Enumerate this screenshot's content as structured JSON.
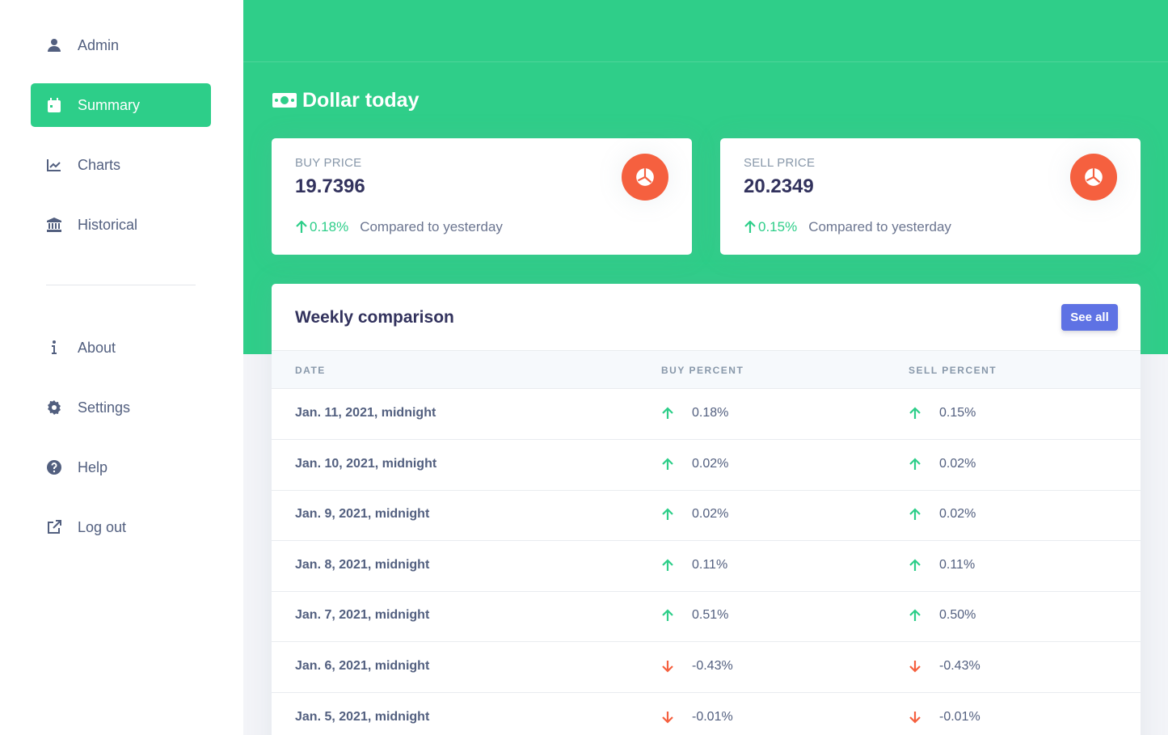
{
  "sidebar": {
    "items": [
      {
        "label": "Admin",
        "icon": "user-icon"
      },
      {
        "label": "Summary",
        "icon": "calendar-icon",
        "active": true
      },
      {
        "label": "Charts",
        "icon": "chart-line-icon"
      },
      {
        "label": "Historical",
        "icon": "bank-icon"
      },
      {
        "label": "About",
        "icon": "info-icon"
      },
      {
        "label": "Settings",
        "icon": "gear-icon"
      },
      {
        "label": "Help",
        "icon": "question-icon"
      },
      {
        "label": "Log out",
        "icon": "external-link-icon"
      }
    ]
  },
  "header": {
    "title": "Dollar today",
    "title_icon": "money-bill-icon"
  },
  "cards": {
    "buy": {
      "label": "BUY PRICE",
      "value": "19.7396",
      "change": "0.18%",
      "compare": "Compared to yesterday",
      "icon": "pie-chart-icon"
    },
    "sell": {
      "label": "SELL PRICE",
      "value": "20.2349",
      "change": "0.15%",
      "compare": "Compared to yesterday",
      "icon": "pie-chart-icon"
    }
  },
  "weekly": {
    "title": "Weekly comparison",
    "see_all": "See all",
    "columns": [
      "DATE",
      "BUY PERCENT",
      "SELL PERCENT"
    ],
    "rows": [
      {
        "date": "Jan. 11, 2021, midnight",
        "buy": "0.18%",
        "buy_dir": "up",
        "sell": "0.15%",
        "sell_dir": "up"
      },
      {
        "date": "Jan. 10, 2021, midnight",
        "buy": "0.02%",
        "buy_dir": "up",
        "sell": "0.02%",
        "sell_dir": "up"
      },
      {
        "date": "Jan. 9, 2021, midnight",
        "buy": "0.02%",
        "buy_dir": "up",
        "sell": "0.02%",
        "sell_dir": "up"
      },
      {
        "date": "Jan. 8, 2021, midnight",
        "buy": "0.11%",
        "buy_dir": "up",
        "sell": "0.11%",
        "sell_dir": "up"
      },
      {
        "date": "Jan. 7, 2021, midnight",
        "buy": "0.51%",
        "buy_dir": "up",
        "sell": "0.50%",
        "sell_dir": "up"
      },
      {
        "date": "Jan. 6, 2021, midnight",
        "buy": "-0.43%",
        "buy_dir": "down",
        "sell": "-0.43%",
        "sell_dir": "down"
      },
      {
        "date": "Jan. 5, 2021, midnight",
        "buy": "-0.01%",
        "buy_dir": "down",
        "sell": "-0.01%",
        "sell_dir": "down"
      }
    ]
  },
  "colors": {
    "primary_green": "#2dce89",
    "accent_orange": "#f5603f",
    "button_blue": "#5e72e4",
    "up": "#2dce89",
    "down": "#f5603f"
  }
}
